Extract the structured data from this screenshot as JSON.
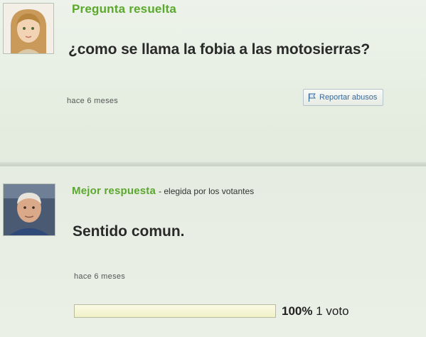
{
  "question": {
    "status_title": "Pregunta resuelta",
    "text": "¿como se llama la fobia a las motosierras?",
    "timestamp": "hace 6 meses",
    "report_label": "Reportar abusos",
    "report_icon": "flag-icon",
    "avatar": "girl-avatar"
  },
  "answer": {
    "title": "Mejor respuesta",
    "subtitle": "- elegida por los votantes",
    "text": "Sentido comun.",
    "timestamp": "hace 6 meses",
    "avatar": "man-avatar",
    "vote_fraction": 1.0,
    "vote_percent": "100%",
    "vote_count": "1 voto"
  },
  "colors": {
    "accent_green": "#5aa82c",
    "link_blue": "#3b6a9a",
    "background": "#e9efe5"
  }
}
